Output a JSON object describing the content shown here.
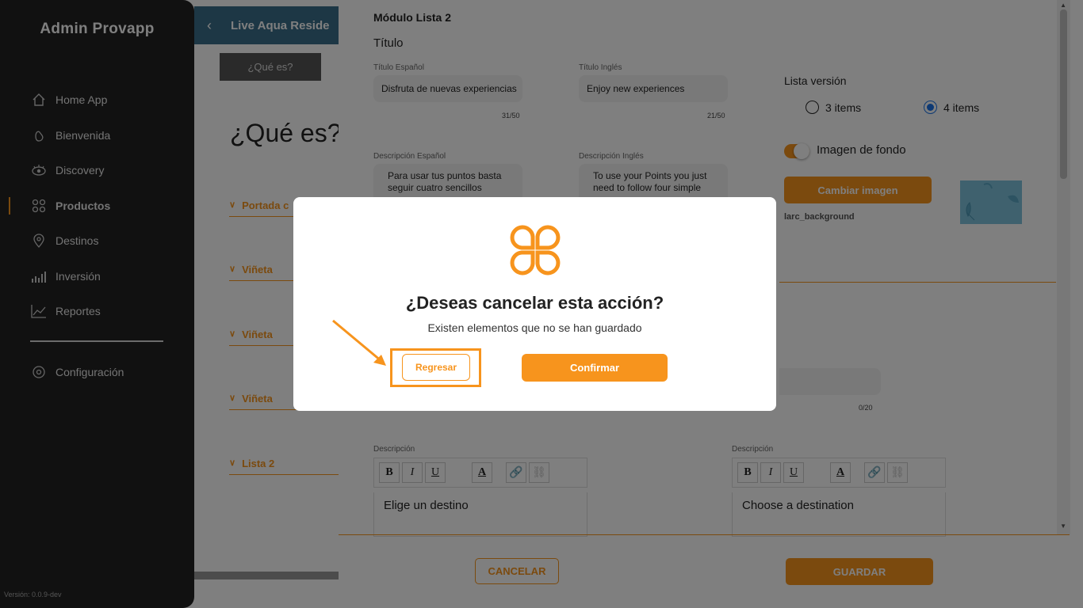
{
  "sidebar": {
    "brand": "Admin Provapp",
    "items": [
      {
        "label": "Home App",
        "icon": "home-icon"
      },
      {
        "label": "Bienvenida",
        "icon": "hand-wave-icon"
      },
      {
        "label": "Discovery",
        "icon": "eye-icon"
      },
      {
        "label": "Productos",
        "icon": "grid-icon",
        "active": true
      },
      {
        "label": "Destinos",
        "icon": "location-pin-icon"
      },
      {
        "label": "Inversión",
        "icon": "bar-chart-icon"
      },
      {
        "label": "Reportes",
        "icon": "line-chart-icon"
      },
      {
        "label": "Configuración",
        "icon": "settings-icon"
      }
    ],
    "version": "Versión: 0.0.9-dev"
  },
  "page": {
    "header_title": "Live Aqua Reside",
    "tab": "¿Qué es?",
    "title": "¿Qué es?",
    "accordions": [
      "Portada c",
      "Viñeta",
      "Viñeta",
      "Viñeta",
      "Lista 2"
    ]
  },
  "panel": {
    "module_title": "Módulo Lista 2",
    "section_title": "Título",
    "title_es_label": "Título Español",
    "title_es_value": "Disfruta de nuevas experiencias",
    "title_es_counter": "31/50",
    "title_en_label": "Título Inglés",
    "title_en_value": "Enjoy new experiences",
    "title_en_counter": "21/50",
    "desc_es_label": "Descripción Español",
    "desc_es_value": "Para usar tus puntos basta seguir cuatro sencillos",
    "desc_en_label": "Descripción Inglés",
    "desc_en_value": "To use your Points you just need to follow four simple",
    "list_version_label": "Lista versión",
    "radio_3": "3 items",
    "radio_4": "4 items",
    "bg_toggle_label": "Imagen de fondo",
    "change_image": "Cambiar imagen",
    "bg_name": "larc_background",
    "small_counter": "0/20",
    "desc_label_1": "Descripción",
    "desc_label_2": "Descripción",
    "editor_es": "Elige un destino",
    "editor_en": "Choose a destination",
    "cancel": "CANCELAR",
    "save": "GUARDAR",
    "toolbar": {
      "bold": "B",
      "italic": "I",
      "underline": "U",
      "color": "A"
    }
  },
  "modal": {
    "title": "¿Deseas cancelar esta acción?",
    "message": "Existen elementos que no se han guardado",
    "back_button": "Regresar",
    "confirm_button": "Confirmar"
  },
  "colors": {
    "accent": "#f7941d",
    "sidebar": "#222222",
    "overlay": "rgba(0,0,0,0.5)"
  }
}
